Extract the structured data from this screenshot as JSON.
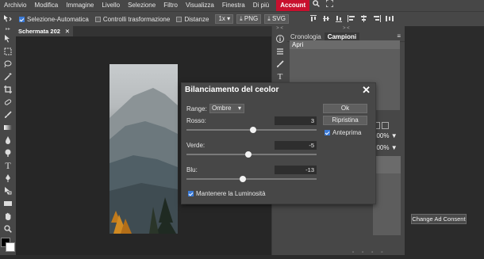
{
  "menubar": {
    "items": [
      "Archivio",
      "Modifica",
      "Immagine",
      "Livello",
      "Selezione",
      "Filtro",
      "Visualizza",
      "Finestra",
      "Di più"
    ],
    "account": "Account"
  },
  "options": {
    "auto_select": "Selezione-Automatica",
    "transform_controls": "Controlli trasformazione",
    "distances": "Distanze",
    "zoom": "1x",
    "png": "PNG",
    "svg": "SVG"
  },
  "document": {
    "tab_label": "Schermata 202",
    "close": "✕"
  },
  "panel": {
    "tab_history": "Cronologia",
    "tab_swatches": "Campioni",
    "history_items": [
      "Apri"
    ],
    "collapse": "> <",
    "layer_opacity": "100%",
    "layer_fill": "100%"
  },
  "ad": {
    "consent_button": "Change Ad Consent"
  },
  "dialog": {
    "title": "Bilanciamento del ceolor",
    "close": "✕",
    "range_label": "Range:",
    "range_value": "Ombre",
    "red_label": "Rosso:",
    "red_value": "3",
    "green_label": "Verde:",
    "green_value": "-5",
    "blue_label": "Blu:",
    "blue_value": "-13",
    "preserve_luminosity": "Mantenere la Luminosità",
    "ok": "Ok",
    "reset": "Ripristina",
    "preview": "Anteprima",
    "slider_range": [
      -100,
      100
    ]
  },
  "colors": {
    "accent": "#c8102e",
    "checkbox": "#3b7bd8"
  }
}
